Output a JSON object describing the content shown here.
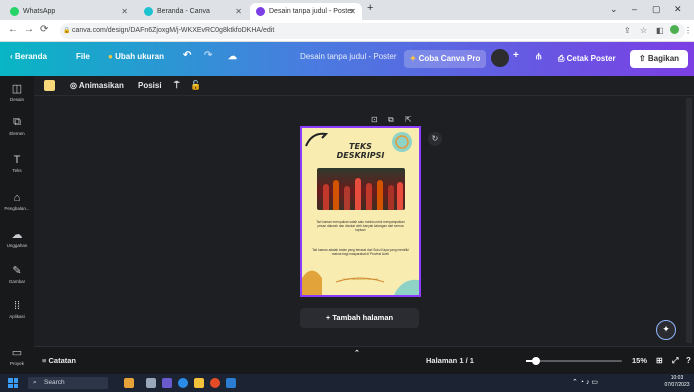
{
  "browser": {
    "tabs": [
      {
        "label": "WhatsApp",
        "icon": "whatsapp-icon",
        "color": "#25d366",
        "active": false
      },
      {
        "label": "Beranda - Canva",
        "icon": "canva-icon",
        "color": "#1ec3d0",
        "active": false
      },
      {
        "label": "Desain tanpa judul - Poster",
        "icon": "canva-icon",
        "color": "#7b3fe4",
        "active": true
      }
    ],
    "url": "canva.com/design/DAFn6ZjoxgM/j-WKXEvRC0g8ktkfoDKHA/edit"
  },
  "canva_bar": {
    "home": "Beranda",
    "file": "File",
    "resize": "Ubah ukuran",
    "doc_title": "Desain tanpa judul - Poster",
    "try_pro": "Coba Canva Pro",
    "print": "Cetak Poster",
    "share": "Bagikan"
  },
  "sidebar": [
    {
      "label": "Desain",
      "icon": "template-icon"
    },
    {
      "label": "Elemen",
      "icon": "elements-icon"
    },
    {
      "label": "Teks",
      "icon": "text-icon"
    },
    {
      "label": "Pengbalan...",
      "icon": "brand-icon"
    },
    {
      "label": "Unggahan",
      "icon": "upload-icon"
    },
    {
      "label": "Gambar",
      "icon": "draw-icon"
    },
    {
      "label": "Aplikasi",
      "icon": "apps-icon"
    },
    {
      "label": "Proyek",
      "icon": "folder-icon"
    }
  ],
  "toolbar": {
    "animate": "Animasikan",
    "position": "Posisi"
  },
  "poster": {
    "title_line1": "TEKS",
    "title_line2": "DESKRIPSI",
    "para1": "Tari kaman merupakan salah satu media untuk menyampaikan pesan dakwah dan disukai oleh banyak kalangan dari semua lapisan",
    "para2": "Tari kaman adalah tarian yang berasal dari Suku Kaya yang memiliki makna bagi masyarakat di Provinsi Aceh",
    "footer": "tarian tradisional indonesia",
    "background": "#f8ecb0"
  },
  "add_page": "+ Tambah halaman",
  "bottom": {
    "notes": "Catatan",
    "page_indicator": "Halaman 1 / 1",
    "zoom": "15%",
    "zoom_fraction": 0.1
  },
  "taskbar": {
    "search": "Search",
    "time": "10:03",
    "date": "07/07/2023"
  }
}
